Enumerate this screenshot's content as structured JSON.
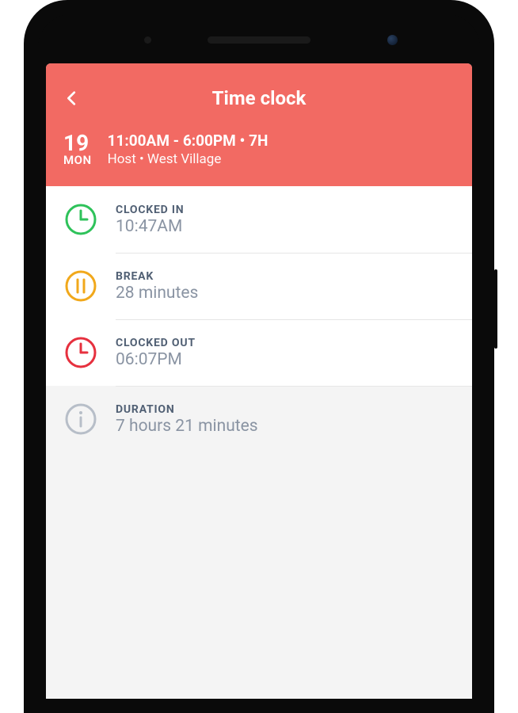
{
  "header": {
    "title": "Time clock",
    "date_num": "19",
    "date_dow": "MON",
    "shift_time": "11:00AM - 6:00PM • 7H",
    "shift_meta": "Host • West Village"
  },
  "rows": {
    "clocked_in": {
      "label": "CLOCKED IN",
      "value": "10:47AM",
      "color": "#2ec25a"
    },
    "break": {
      "label": "BREAK",
      "value": "28 minutes",
      "color": "#f1a81b"
    },
    "clocked_out": {
      "label": "CLOCKED OUT",
      "value": "06:07PM",
      "color": "#e6303e"
    },
    "duration": {
      "label": "DURATION",
      "value": "7 hours 21 minutes",
      "color": "#b7bec8"
    }
  }
}
